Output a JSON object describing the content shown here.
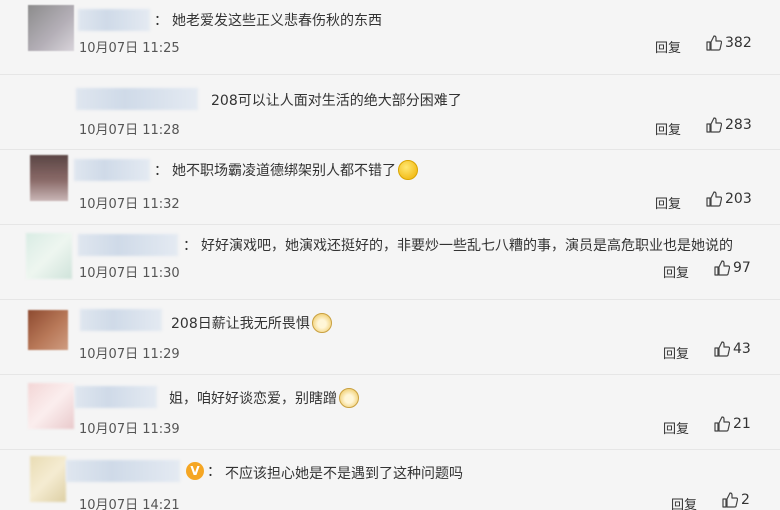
{
  "comments": [
    {
      "text": "她老爱发这些正义悲春伤秋的东西",
      "time": "10月07日 11:25",
      "reply_label": "回复",
      "likes": "382"
    },
    {
      "text": "208可以让人面对生活的绝大部分困难了",
      "time": "10月07日 11:28",
      "reply_label": "回复",
      "likes": "283"
    },
    {
      "text": "她不职场霸凌道德绑架别人都不错了",
      "time": "10月07日 11:32",
      "reply_label": "回复",
      "likes": "203"
    },
    {
      "text": "好好演戏吧，她演戏还挺好的，非要炒一些乱七八糟的事，演员是高危职业也是她说的",
      "time": "10月07日 11:30",
      "reply_label": "回复",
      "likes": "97"
    },
    {
      "text": "208日薪让我无所畏惧",
      "time": "10月07日 11:29",
      "reply_label": "回复",
      "likes": "43"
    },
    {
      "text": "姐，咱好好谈恋爱，别瞎蹭",
      "time": "10月07日 11:39",
      "reply_label": "回复",
      "likes": "21"
    },
    {
      "text": "不应该担心她是不是遇到了这种问题吗",
      "time": "10月07日 14:21",
      "reply_label": "回复",
      "likes": "2"
    }
  ],
  "colon": "：",
  "vip_badge": "V"
}
